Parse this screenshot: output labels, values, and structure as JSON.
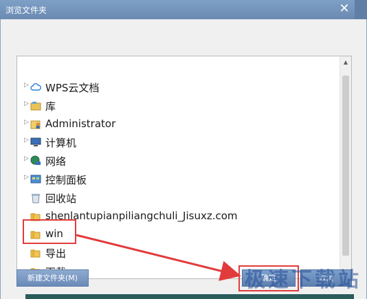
{
  "window": {
    "title": "浏览文件夹",
    "close_glyph": "✕"
  },
  "tree": {
    "items": [
      {
        "label": "WPS云文档",
        "icon": "cloud-icon",
        "expander": true
      },
      {
        "label": "库",
        "icon": "library-icon",
        "expander": true
      },
      {
        "label": "Administrator",
        "icon": "user-folder-icon",
        "expander": true
      },
      {
        "label": "计算机",
        "icon": "computer-icon",
        "expander": true
      },
      {
        "label": "网络",
        "icon": "network-icon",
        "expander": true
      },
      {
        "label": "控制面板",
        "icon": "control-panel-icon",
        "expander": true
      },
      {
        "label": "回收站",
        "icon": "recycle-bin-icon",
        "expander": false
      },
      {
        "label": "shenlantupianpiliangchuli_Jisuxz.com",
        "icon": "folder-icon",
        "expander": false
      },
      {
        "label": "win",
        "icon": "folder-icon",
        "expander": false
      },
      {
        "label": "导出",
        "icon": "folder-icon",
        "expander": false,
        "selected": true
      },
      {
        "label": "下载",
        "icon": "folder-icon",
        "expander": false
      }
    ]
  },
  "buttons": {
    "new_folder": "新建文件夹(M)",
    "ok": "确定",
    "cancel": "取消"
  },
  "watermark": "极速下载站",
  "colors": {
    "highlight_red": "#e23b3b",
    "button_blue": "#6a8bb8",
    "titlebar_blue": "#7e9fc6"
  }
}
